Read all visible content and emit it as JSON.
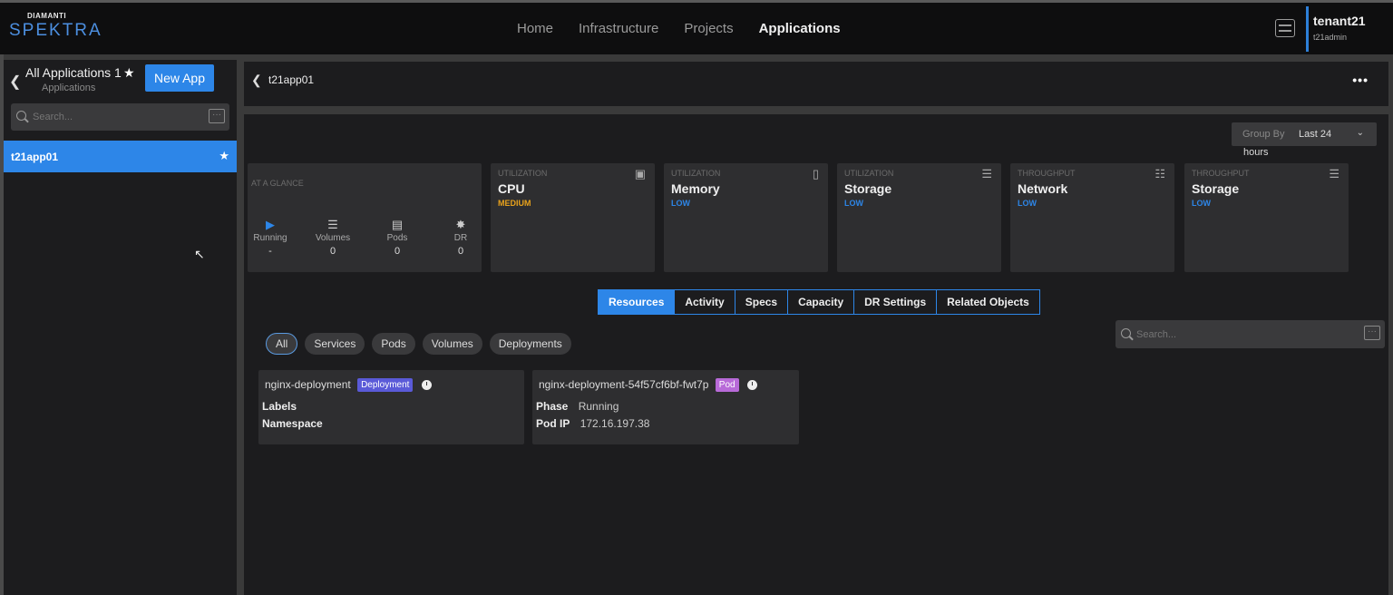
{
  "brand": {
    "small": "DIAMANTI",
    "name": "SPEKTRA"
  },
  "nav": {
    "items": [
      "Home",
      "Infrastructure",
      "Projects",
      "Applications"
    ],
    "active": "Applications"
  },
  "user": {
    "tenant": "tenant21",
    "username": "t21admin"
  },
  "sidebar": {
    "title": "All Applications 1",
    "subtitle": "Applications",
    "new_app_label": "New App",
    "search_placeholder": "Search...",
    "apps": [
      {
        "label": "t21app01"
      }
    ]
  },
  "header": {
    "title": "t21app01",
    "more_label": "•••"
  },
  "group_by": {
    "label": "Group By",
    "value": "Last 24",
    "unit": "hours"
  },
  "glance": {
    "title": "AT A GLANCE",
    "stats": [
      {
        "label": "Running",
        "value": "-",
        "icon": "play-circle-icon"
      },
      {
        "label": "Volumes",
        "value": "0",
        "icon": "database-icon"
      },
      {
        "label": "Pods",
        "value": "0",
        "icon": "pod-icon"
      },
      {
        "label": "DR",
        "value": "0",
        "icon": "dr-icon"
      }
    ]
  },
  "metrics": [
    {
      "category": "UTILIZATION",
      "name": "CPU",
      "level": "MEDIUM",
      "level_color": "#e8a21c",
      "icon": "cpu-icon"
    },
    {
      "category": "UTILIZATION",
      "name": "Memory",
      "level": "LOW",
      "level_color": "#2d86e8",
      "icon": "memory-icon"
    },
    {
      "category": "UTILIZATION",
      "name": "Storage",
      "level": "LOW",
      "level_color": "#2d86e8",
      "icon": "database-icon"
    },
    {
      "category": "THROUGHPUT",
      "name": "Network",
      "level": "LOW",
      "level_color": "#2d86e8",
      "icon": "network-icon"
    },
    {
      "category": "THROUGHPUT",
      "name": "Storage",
      "level": "LOW",
      "level_color": "#2d86e8",
      "icon": "database-icon"
    }
  ],
  "tabs": [
    "Resources",
    "Activity",
    "Specs",
    "Capacity",
    "DR Settings",
    "Related Objects"
  ],
  "active_tab": "Resources",
  "filters": [
    "All",
    "Services",
    "Pods",
    "Volumes",
    "Deployments"
  ],
  "active_filter": "All",
  "main_search_placeholder": "Search...",
  "resources": [
    {
      "name": "nginx-deployment",
      "badge": "Deployment",
      "rows": [
        {
          "key": "Labels",
          "value": ""
        },
        {
          "key": "Namespace",
          "value": ""
        }
      ]
    },
    {
      "name": "nginx-deployment-54f57cf6bf-fwt7p",
      "badge": "Pod",
      "rows": [
        {
          "key": "Phase",
          "value": "Running"
        },
        {
          "key": "Pod IP",
          "value": "172.16.197.38"
        }
      ]
    }
  ],
  "colors": {
    "accent": "#2d86e8",
    "medium": "#e8a21c"
  }
}
